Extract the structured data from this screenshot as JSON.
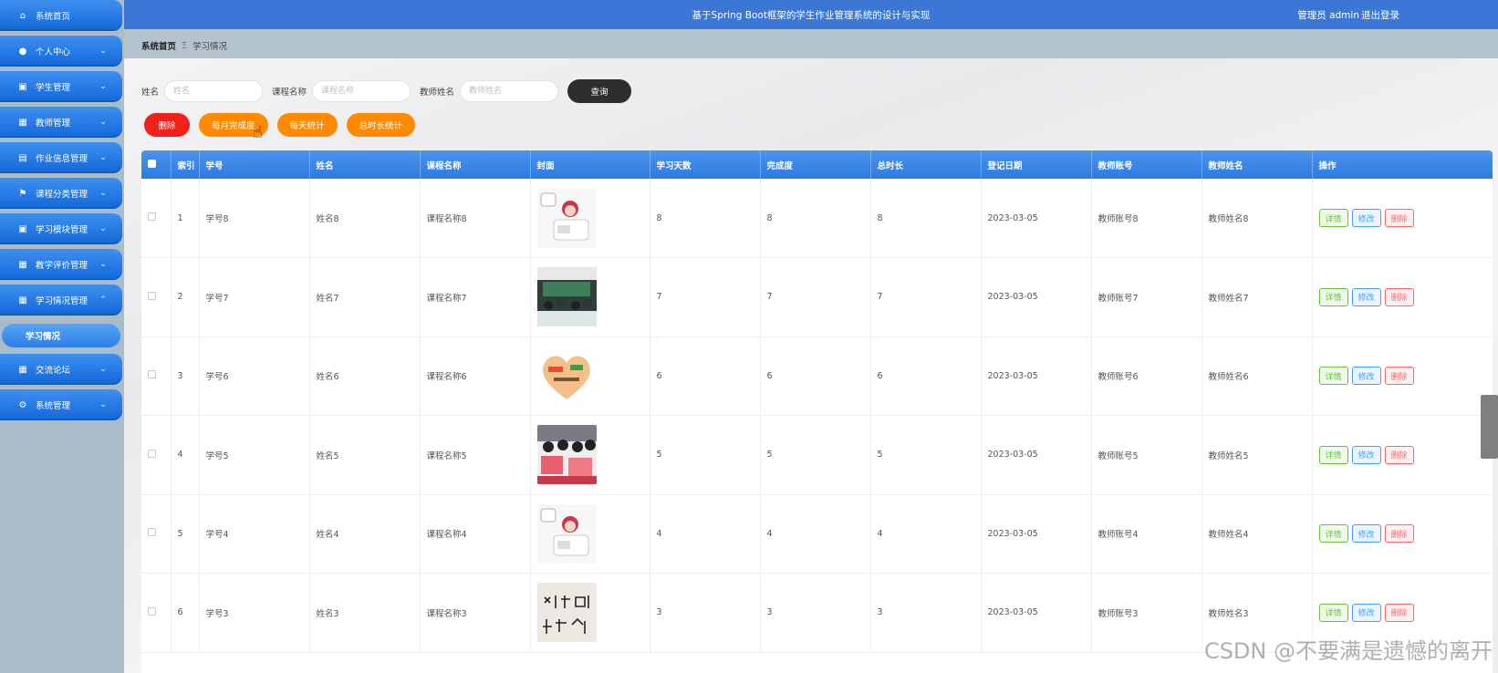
{
  "header": {
    "title": "基于Spring Boot框架的学生作业管理系统的设计与实现",
    "user": "管理员 admin",
    "logout": "退出登录"
  },
  "breadcrumb": {
    "home": "系统首页",
    "separator": "Ξ",
    "current": "学习情况"
  },
  "sidebar": {
    "items": [
      {
        "label": "系统首页",
        "icon": "home-icon"
      },
      {
        "label": "个人中心",
        "icon": "user-icon"
      },
      {
        "label": "学生管理",
        "icon": "clipboard-icon"
      },
      {
        "label": "教师管理",
        "icon": "grid-icon"
      },
      {
        "label": "作业信息管理",
        "icon": "briefcase-icon"
      },
      {
        "label": "课程分类管理",
        "icon": "flag-icon"
      },
      {
        "label": "学习模块管理",
        "icon": "clipboard-icon"
      },
      {
        "label": "教学评价管理",
        "icon": "grid-icon"
      },
      {
        "label": "学习情况管理",
        "icon": "grid-icon"
      },
      {
        "label": "交流论坛",
        "icon": "grid-icon"
      },
      {
        "label": "系统管理",
        "icon": "settings-icon"
      }
    ],
    "sub_item": "学习情况"
  },
  "search": {
    "name_label": "姓名",
    "name_placeholder": "姓名",
    "course_label": "课程名称",
    "course_placeholder": "课程名称",
    "teacher_label": "教师姓名",
    "teacher_placeholder": "教师姓名",
    "query_button": "查询"
  },
  "actions": {
    "delete": "删除",
    "monthly": "每月完成度",
    "daily": "每天统计",
    "total": "总时长统计"
  },
  "table": {
    "columns": [
      "索引",
      "学号",
      "姓名",
      "课程名称",
      "封面",
      "学习天数",
      "完成度",
      "总时长",
      "登记日期",
      "教师账号",
      "教师姓名",
      "操作"
    ],
    "rows": [
      {
        "index": "1",
        "student_no": "学号8",
        "name": "姓名8",
        "course": "课程名称8",
        "days": "8",
        "completion": "8",
        "total": "8",
        "date": "2023-03-05",
        "teacher_account": "教师账号8",
        "teacher_name": "教师姓名8",
        "cover": "girl-sticker"
      },
      {
        "index": "2",
        "student_no": "学号7",
        "name": "姓名7",
        "course": "课程名称7",
        "days": "7",
        "completion": "7",
        "total": "7",
        "date": "2023-03-05",
        "teacher_account": "教师账号7",
        "teacher_name": "教师姓名7",
        "cover": "classroom-photo"
      },
      {
        "index": "3",
        "student_no": "学号6",
        "name": "姓名6",
        "course": "课程名称6",
        "days": "6",
        "completion": "6",
        "total": "6",
        "date": "2023-03-05",
        "teacher_account": "教师账号6",
        "teacher_name": "教师姓名6",
        "cover": "heart-sticker"
      },
      {
        "index": "4",
        "student_no": "学号5",
        "name": "姓名5",
        "course": "课程名称5",
        "days": "5",
        "completion": "5",
        "total": "5",
        "date": "2023-03-05",
        "teacher_account": "教师账号5",
        "teacher_name": "教师姓名5",
        "cover": "students-reading"
      },
      {
        "index": "5",
        "student_no": "学号4",
        "name": "姓名4",
        "course": "课程名称4",
        "days": "4",
        "completion": "4",
        "total": "4",
        "date": "2023-03-05",
        "teacher_account": "教师账号4",
        "teacher_name": "教师姓名4",
        "cover": "girl-sticker"
      },
      {
        "index": "6",
        "student_no": "学号3",
        "name": "姓名3",
        "course": "课程名称3",
        "days": "3",
        "completion": "3",
        "total": "3",
        "date": "2023-03-05",
        "teacher_account": "教师账号3",
        "teacher_name": "教师姓名3",
        "cover": "handwriting"
      }
    ],
    "op_detail": "详情",
    "op_edit": "修改",
    "op_delete": "删除"
  },
  "watermark": "CSDN @不要满是遗憾的离开"
}
